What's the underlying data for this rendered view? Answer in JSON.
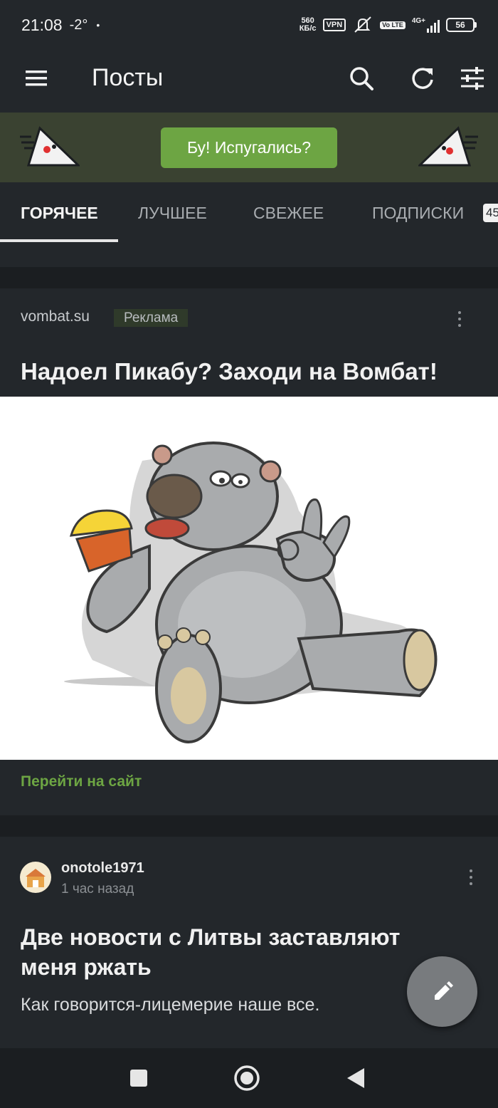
{
  "status_bar": {
    "time": "21:08",
    "temperature": "-2°",
    "dot": "•",
    "speed_value": "560",
    "speed_unit": "КБ/с",
    "vpn": "VPN",
    "volte": "Vo LTE",
    "network": "4G+",
    "battery": "56"
  },
  "app_bar": {
    "title": "Посты",
    "icons": [
      "menu-icon",
      "search-icon",
      "refresh-icon",
      "filter-sliders-icon"
    ]
  },
  "banner": {
    "button_label": "Бу! Испугались?",
    "mascot_icon": "pikabu-ghost-mascot"
  },
  "tabs": {
    "items": [
      {
        "label": "ГОРЯЧЕЕ",
        "active": true
      },
      {
        "label": "ЛУЧШЕЕ",
        "active": false
      },
      {
        "label": "СВЕЖЕЕ",
        "active": false
      },
      {
        "label": "ПОДПИСКИ",
        "active": false
      }
    ],
    "badge": "45"
  },
  "ad": {
    "source": "vombat.su",
    "label": "Реклама",
    "title": "Надоел Пикабу? Заходи на Вомбат!",
    "image_icon": "wombat-eating-cupcake-illustration",
    "link": "Перейти на сайт"
  },
  "post": {
    "author": "onotole1971",
    "time": "1 час назад",
    "title": "Две новости с Литвы заставляют меня ржать",
    "text": "Как говорится-лицемерие наше все."
  },
  "fab": {
    "icon": "pencil-icon"
  },
  "colors": {
    "background": "#1b1e21",
    "surface": "#23272b",
    "accent_green": "#6da543",
    "banner_bg": "#3a4231"
  }
}
